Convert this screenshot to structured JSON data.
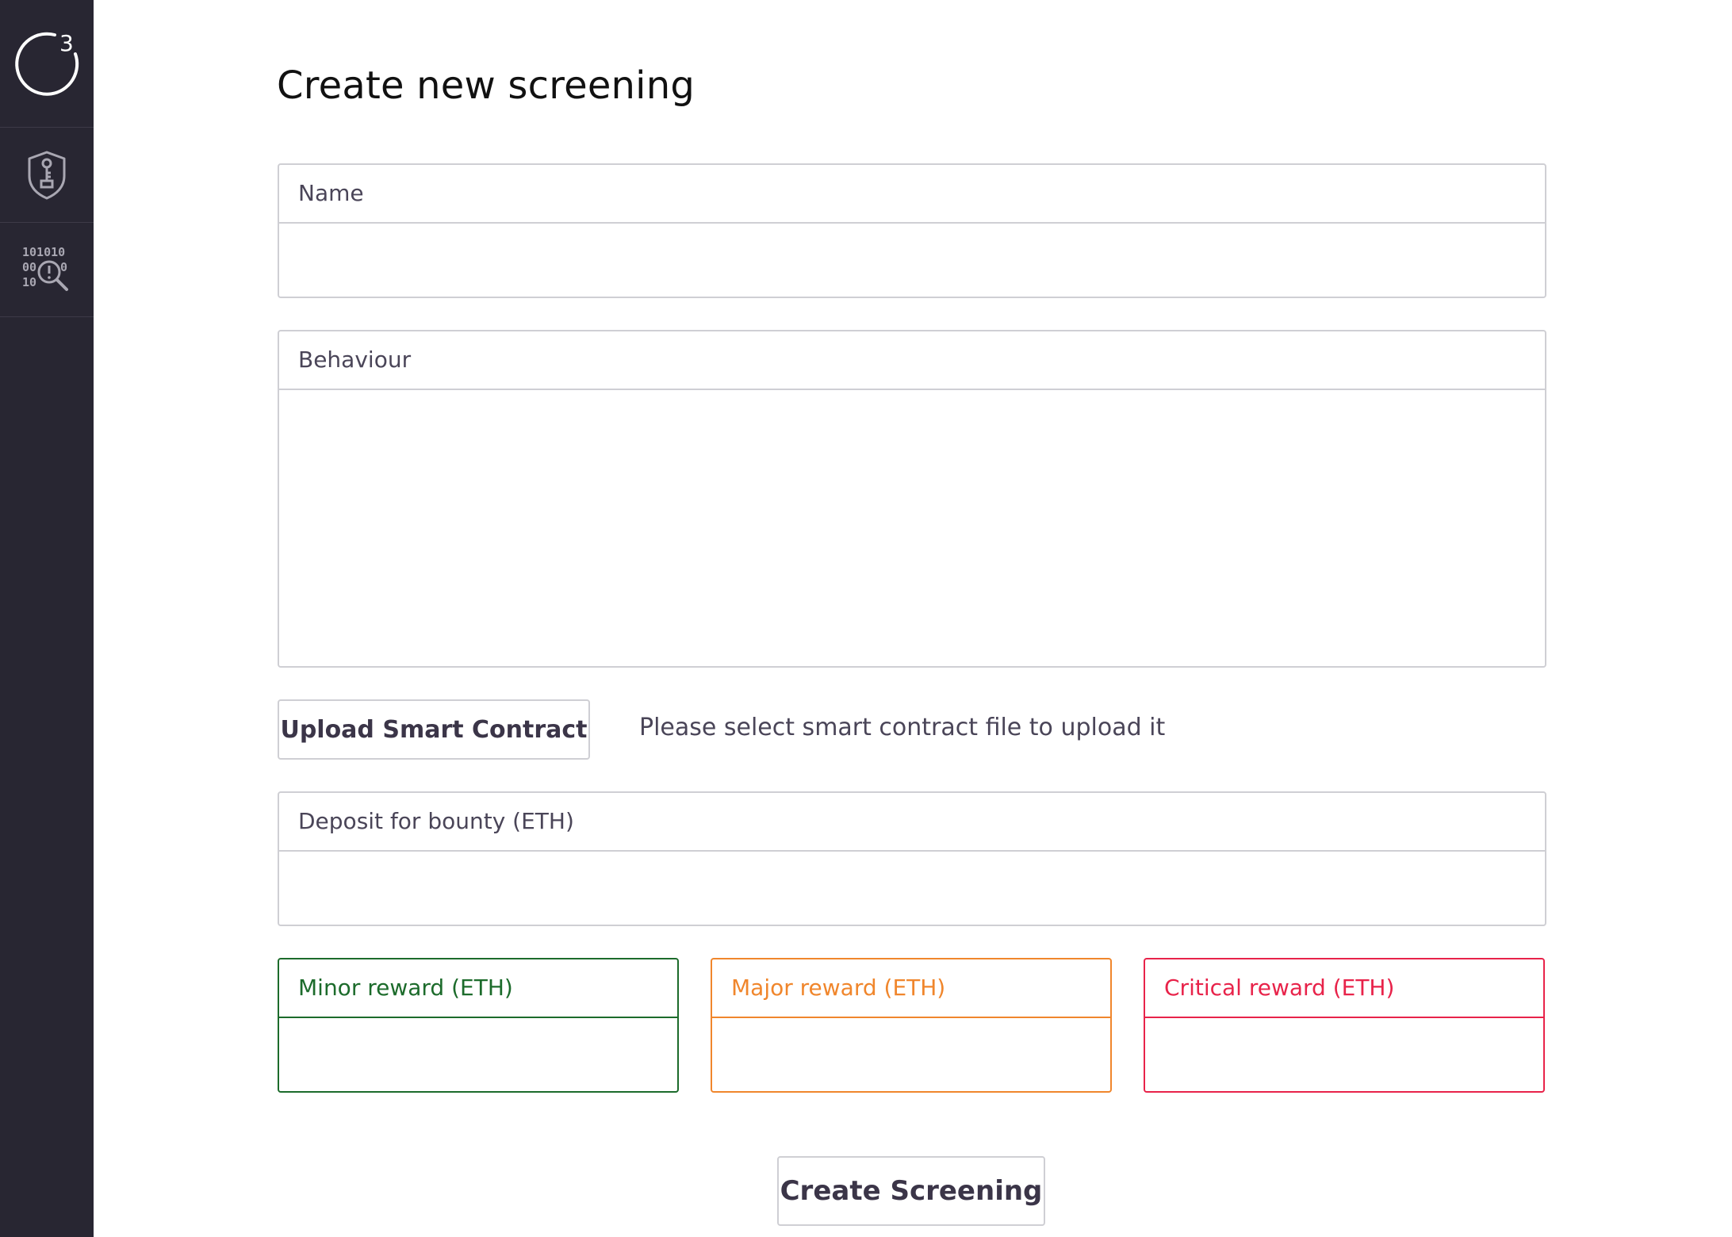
{
  "sidebar": {
    "logo_superscript": "3",
    "items": [
      {
        "icon": "shield-key-icon"
      },
      {
        "icon": "binary-search-alert-icon"
      }
    ]
  },
  "page": {
    "title": "Create new screening"
  },
  "form": {
    "name": {
      "label": "Name",
      "value": ""
    },
    "behaviour": {
      "label": "Behaviour",
      "value": ""
    },
    "upload_button_label": "Upload Smart Contract",
    "upload_hint": "Please select smart contract file to upload it",
    "deposit": {
      "label": "Deposit for bounty (ETH)",
      "value": ""
    },
    "rewards": {
      "minor": {
        "label": "Minor reward (ETH)",
        "value": "",
        "color": "#1c6b2b"
      },
      "major": {
        "label": "Major reward (ETH)",
        "value": "",
        "color": "#f0862c"
      },
      "critical": {
        "label": "Critical reward (ETH)",
        "value": "",
        "color": "#e8234a"
      }
    },
    "submit_label": "Create Screening"
  },
  "colors": {
    "sidebar_bg": "#282632",
    "border": "#cfcfd4",
    "text": "#4a4558"
  }
}
